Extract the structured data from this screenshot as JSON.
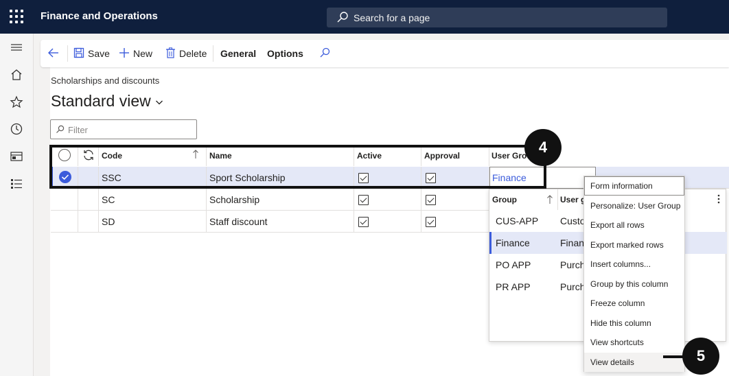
{
  "header": {
    "app_title": "Finance and Operations",
    "search_placeholder": "Search for a page",
    "bg_color": "#0f1f3d"
  },
  "nav": {
    "icons": [
      "hamburger-icon",
      "home-icon",
      "star-icon",
      "clock-icon",
      "workspace-icon",
      "list-icon"
    ]
  },
  "toolbar": {
    "back": "back-arrow-icon",
    "save_label": "Save",
    "new_label": "New",
    "delete_label": "Delete",
    "general_label": "General",
    "options_label": "Options"
  },
  "page": {
    "breadcrumb": "Scholarships and discounts",
    "title": "Standard view",
    "filter_placeholder": "Filter"
  },
  "grid": {
    "columns": [
      "Code",
      "Name",
      "Active",
      "Approval",
      "User Group"
    ],
    "rows": [
      {
        "code": "SSC",
        "name": "Sport Scholarship",
        "active": true,
        "approval": true,
        "user_group": "Finance",
        "selected": true
      },
      {
        "code": "SC",
        "name": "Scholarship",
        "active": true,
        "approval": true,
        "user_group": "",
        "selected": false
      },
      {
        "code": "SD",
        "name": "Staff discount",
        "active": true,
        "approval": true,
        "user_group": "",
        "selected": false
      }
    ]
  },
  "lookup": {
    "columns": [
      "Group",
      "User g"
    ],
    "rows": [
      {
        "group": "CUS-APP",
        "user_group": "Custo"
      },
      {
        "group": "Finance",
        "user_group": "Finan"
      },
      {
        "group": "PO APP",
        "user_group": "Purch"
      },
      {
        "group": "PR APP",
        "user_group": "Purch"
      }
    ]
  },
  "context_menu": {
    "items": [
      "Form information",
      "Personalize: User Group",
      "Export all rows",
      "Export marked rows",
      "Insert columns...",
      "Group by this column",
      "Freeze column",
      "Hide this column",
      "View shortcuts",
      "View details"
    ]
  },
  "callouts": {
    "step4": "4",
    "step5": "5"
  },
  "colors": {
    "accent": "#3b5bdb",
    "selected_row": "#e4e8f7"
  }
}
